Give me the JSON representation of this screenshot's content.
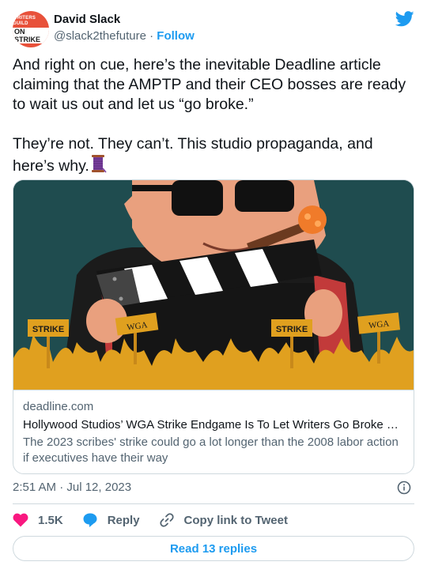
{
  "author": {
    "display_name": "David Slack",
    "handle": "@slack2thefuture",
    "separator": " · ",
    "follow_label": "Follow",
    "avatar_text_top": "WRITERS GUILD",
    "avatar_text_bottom": "ON STRIKE"
  },
  "tweet": {
    "text": "And right on cue, here’s the inevitable Deadline article claiming that the AMPTP and their CEO bosses are ready to wait us out and let us “go broke.”\n\nThey’re not. They can’t. This studio propaganda, and here’s why.",
    "emoji_icon": "spool-of-thread-icon"
  },
  "card": {
    "domain": "deadline.com",
    "title": "Hollywood Studios’ WGA Strike Endgame Is To Let Writers Go Broke B…",
    "description": "The 2023 scribes' strike could go a lot longer than the 2008 labor action if executives have their way",
    "sign_labels": [
      "STRIKE",
      "WGA",
      "STRIKE",
      "WGA"
    ]
  },
  "meta": {
    "timestamp": "2:51 AM · Jul 12, 2023"
  },
  "actions": {
    "like_count": "1.5K",
    "reply_label": "Reply",
    "copy_link_label": "Copy link to Tweet"
  },
  "read_replies_label": "Read 13 replies",
  "colors": {
    "brand_blue": "#1d9bf0",
    "like_pink": "#f91880",
    "secondary_text": "#536471",
    "border": "#cfd9de"
  }
}
